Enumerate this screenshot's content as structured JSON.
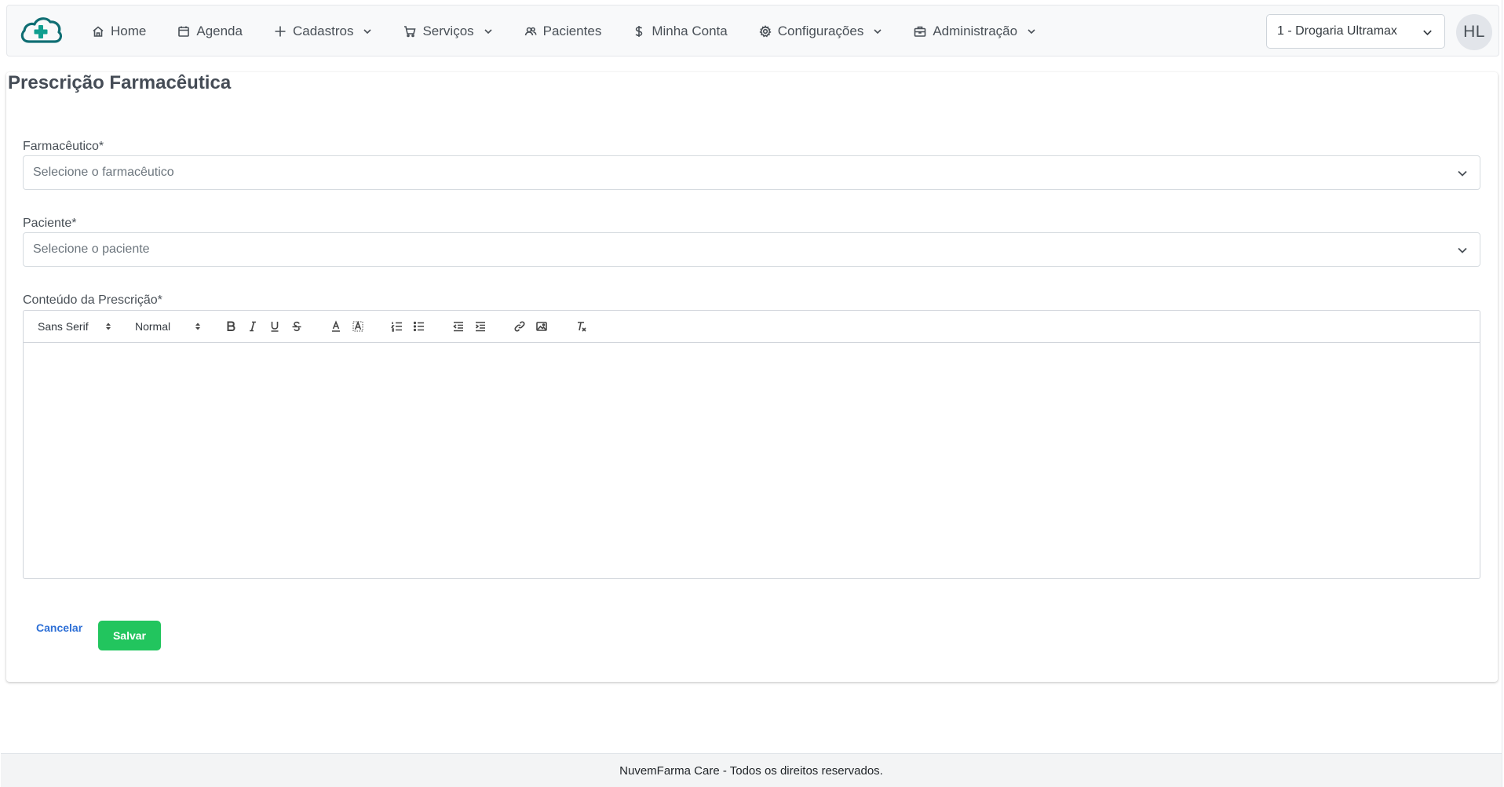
{
  "nav": {
    "items": [
      {
        "label": "Home",
        "icon": "home-icon"
      },
      {
        "label": "Agenda",
        "icon": "calendar-icon"
      },
      {
        "label": "Cadastros",
        "icon": "plus-icon",
        "dropdown": true
      },
      {
        "label": "Serviços",
        "icon": "cart-icon",
        "dropdown": true
      },
      {
        "label": "Pacientes",
        "icon": "users-icon"
      },
      {
        "label": "Minha Conta",
        "icon": "dollar-icon"
      },
      {
        "label": "Configurações",
        "icon": "gear-icon",
        "dropdown": true
      },
      {
        "label": "Administração",
        "icon": "briefcase-icon",
        "dropdown": true
      }
    ],
    "store_select": "1 - Drogaria Ultramax",
    "avatar_initials": "HL"
  },
  "page": {
    "title": "Prescrição Farmacêutica"
  },
  "form": {
    "pharmacist": {
      "label": "Farmacêutico*",
      "placeholder": "Selecione o farmacêutico"
    },
    "patient": {
      "label": "Paciente*",
      "placeholder": "Selecione o paciente"
    },
    "content": {
      "label": "Conteúdo da Prescrição*"
    },
    "toolbar": {
      "font": "Sans Serif",
      "size": "Normal"
    },
    "cancel_label": "Cancelar",
    "save_label": "Salvar"
  },
  "footer": {
    "text": "NuvemFarma Care - Todos os direitos reservados."
  },
  "colors": {
    "brand": "#0f6e73",
    "save": "#22c55e",
    "link": "#2d6fd6"
  }
}
